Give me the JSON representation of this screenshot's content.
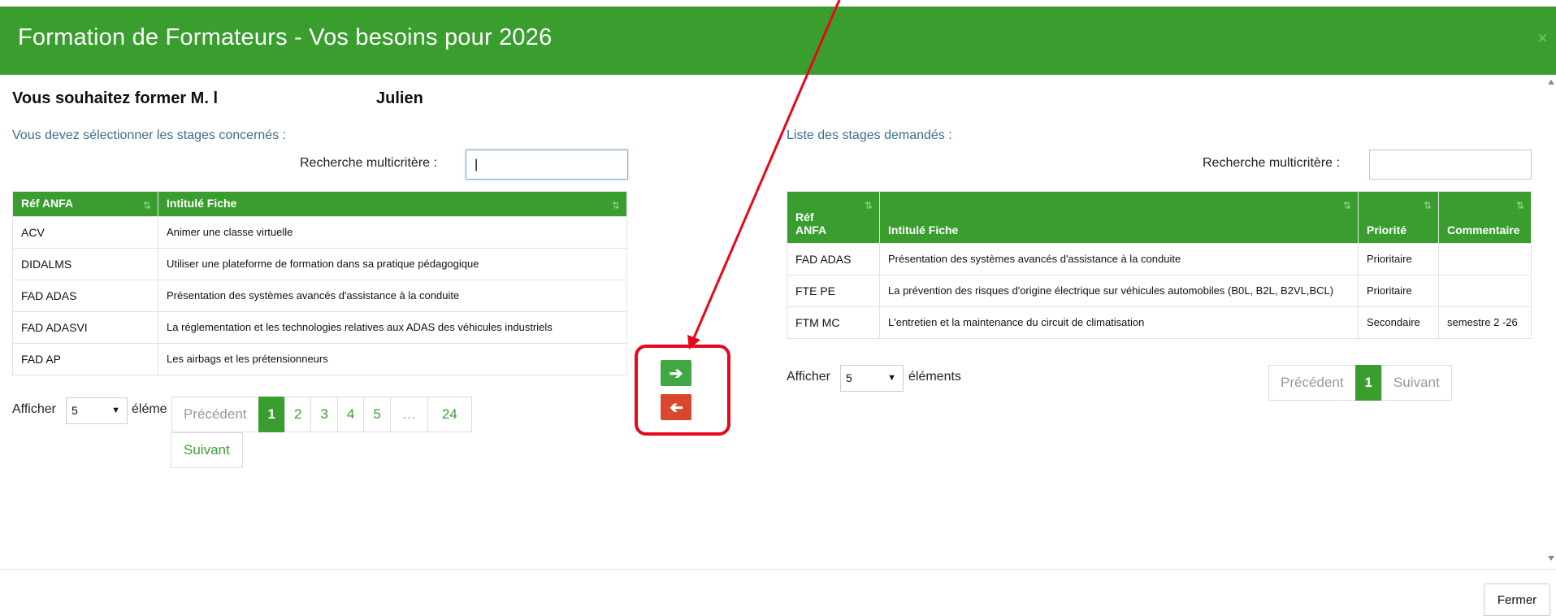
{
  "modal": {
    "title": "Formation de Formateurs - Vos besoins pour 2026",
    "close_glyph": "×",
    "heading_part1": "Vous souhaitez former M. l",
    "heading_part2": "Julien"
  },
  "left_panel": {
    "label": "Vous devez sélectionner les stages concernés :",
    "search_label": "Recherche multicritère :",
    "search_value": "|",
    "columns": [
      "Réf ANFA",
      "Intitulé Fiche"
    ],
    "rows": [
      {
        "ref": "ACV",
        "title": "Animer une classe virtuelle"
      },
      {
        "ref": "DIDALMS",
        "title": "Utiliser une plateforme de formation dans sa pratique pédagogique"
      },
      {
        "ref": "FAD ADAS",
        "title": "Présentation des systèmes avancés d'assistance à la conduite"
      },
      {
        "ref": "FAD ADASVI",
        "title": "La réglementation et les technologies relatives aux ADAS des véhicules industriels"
      },
      {
        "ref": "FAD AP",
        "title": "Les airbags et les prétensionneurs"
      }
    ],
    "length_label": "Afficher",
    "length_value": "5",
    "length_suffix": "éléme",
    "pagination": {
      "prev": "Précédent",
      "pages": [
        "1",
        "2",
        "3",
        "4",
        "5",
        "…",
        "24"
      ],
      "current": "1",
      "next": "Suivant"
    }
  },
  "transfer": {
    "add_icon": "arrow-right-icon",
    "remove_icon": "arrow-left-icon",
    "add_color": "#3fa843",
    "remove_color": "#d9472f",
    "highlight_color": "#e8071c"
  },
  "right_panel": {
    "label": "Liste des stages demandés :",
    "search_label": "Recherche multicritère :",
    "search_value": "",
    "columns": [
      "Réf ANFA",
      "Intitulé Fiche",
      "Priorité",
      "Commentaire"
    ],
    "rows": [
      {
        "ref": "FAD ADAS",
        "title": "Présentation des systèmes avancés d'assistance à la conduite",
        "priority": "Prioritaire",
        "comment": ""
      },
      {
        "ref": "FTE PE",
        "title": "La prévention des risques d'origine électrique sur véhicules automobiles (B0L, B2L, B2VL,BCL)",
        "priority": "Prioritaire",
        "comment": ""
      },
      {
        "ref": "FTM MC",
        "title": "L'entretien et la maintenance du circuit de climatisation",
        "priority": "Secondaire",
        "comment": "semestre 2 -26"
      }
    ],
    "length_label": "Afficher",
    "length_value": "5",
    "length_suffix": "éléments",
    "pagination": {
      "prev": "Précédent",
      "current": "1",
      "next": "Suivant"
    }
  },
  "footer": {
    "close_label": "Fermer"
  },
  "colors": {
    "header_green": "#3a9e2f",
    "label_blue": "#3d6d8f"
  }
}
